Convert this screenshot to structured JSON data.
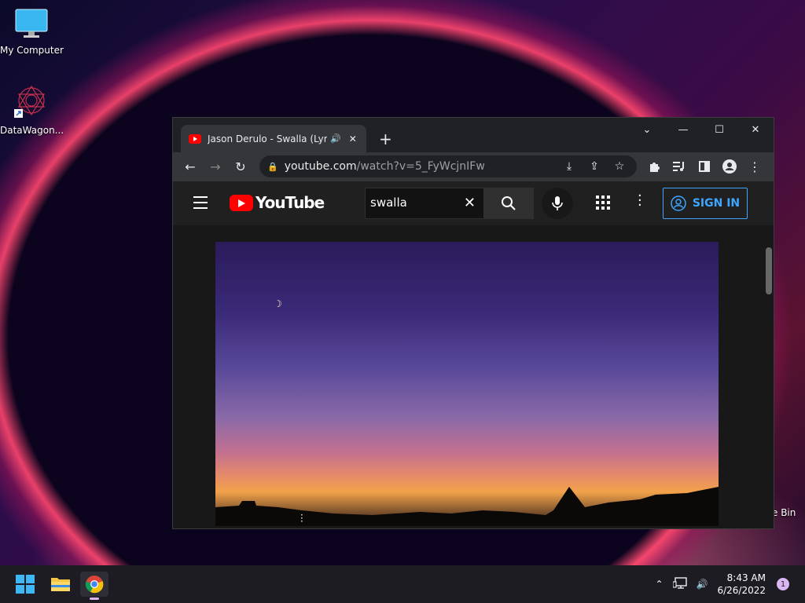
{
  "desktop": {
    "icons": [
      {
        "label": "My Computer"
      },
      {
        "label": "DataWagon..."
      }
    ],
    "recycle_bin_label": "e Bin"
  },
  "browser": {
    "tab": {
      "title": "Jason Derulo - Swalla (Lyrics)",
      "sound_icon": "speaker-icon"
    },
    "url": {
      "host": "youtube.com",
      "path": "/watch?v=5_FyWcjnIFw"
    }
  },
  "youtube": {
    "logo_text": "YouTube",
    "search": {
      "value": "swalla"
    },
    "sign_in_label": "SIGN IN"
  },
  "taskbar": {
    "time": "8:43 AM",
    "date": "6/26/2022",
    "notification_count": "1"
  },
  "colors": {
    "accent": "#3ea6ff",
    "youtube_red": "#ff0000"
  }
}
